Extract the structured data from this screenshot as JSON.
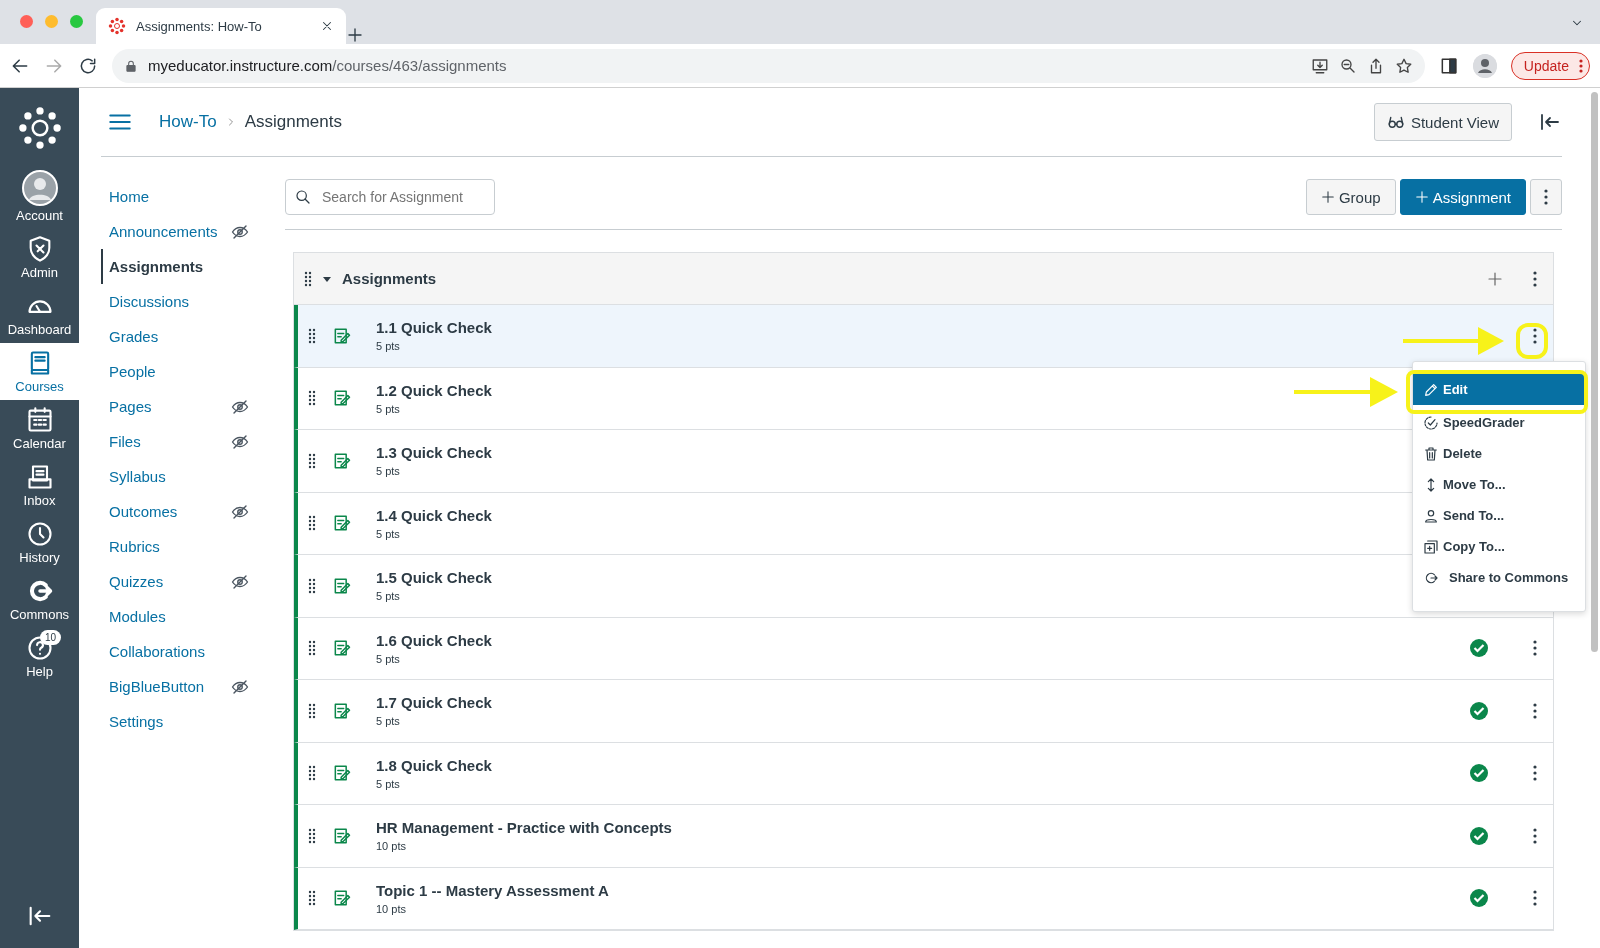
{
  "browser": {
    "tab_title": "Assignments: How-To",
    "url_host": "myeducator.instructure.com",
    "url_path": "/courses/463/assignments",
    "update_button": "Update"
  },
  "global_nav": [
    {
      "label": "Account",
      "kind": "account",
      "selected": false
    },
    {
      "label": "Admin",
      "kind": "admin",
      "selected": false
    },
    {
      "label": "Dashboard",
      "kind": "dashboard",
      "selected": false
    },
    {
      "label": "Courses",
      "kind": "courses",
      "selected": true
    },
    {
      "label": "Calendar",
      "kind": "calendar",
      "selected": false
    },
    {
      "label": "Inbox",
      "kind": "inbox",
      "selected": false
    },
    {
      "label": "History",
      "kind": "history",
      "selected": false
    },
    {
      "label": "Commons",
      "kind": "commons",
      "selected": false
    },
    {
      "label": "Help",
      "kind": "help",
      "selected": false,
      "badge": "10"
    }
  ],
  "breadcrumb": [
    "How-To",
    "Assignments"
  ],
  "student_view_button": "Student View",
  "course_nav": [
    {
      "label": "Home",
      "selected": false,
      "hidden": false
    },
    {
      "label": "Announcements",
      "selected": false,
      "hidden": true
    },
    {
      "label": "Assignments",
      "selected": true,
      "hidden": false
    },
    {
      "label": "Discussions",
      "selected": false,
      "hidden": false
    },
    {
      "label": "Grades",
      "selected": false,
      "hidden": false
    },
    {
      "label": "People",
      "selected": false,
      "hidden": false
    },
    {
      "label": "Pages",
      "selected": false,
      "hidden": true
    },
    {
      "label": "Files",
      "selected": false,
      "hidden": true
    },
    {
      "label": "Syllabus",
      "selected": false,
      "hidden": false
    },
    {
      "label": "Outcomes",
      "selected": false,
      "hidden": true
    },
    {
      "label": "Rubrics",
      "selected": false,
      "hidden": false
    },
    {
      "label": "Quizzes",
      "selected": false,
      "hidden": true
    },
    {
      "label": "Modules",
      "selected": false,
      "hidden": false
    },
    {
      "label": "Collaborations",
      "selected": false,
      "hidden": false
    },
    {
      "label": "BigBlueButton",
      "selected": false,
      "hidden": true
    },
    {
      "label": "Settings",
      "selected": false,
      "hidden": false
    }
  ],
  "search": {
    "placeholder": "Search for Assignment"
  },
  "buttons": {
    "group": "Group",
    "assignment": "Assignment"
  },
  "assignment_group": {
    "title": "Assignments",
    "expanded": true,
    "items": [
      {
        "title": "1.1 Quick Check",
        "points": "5 pts",
        "selected": true
      },
      {
        "title": "1.2 Quick Check",
        "points": "5 pts",
        "selected": false
      },
      {
        "title": "1.3 Quick Check",
        "points": "5 pts",
        "selected": false
      },
      {
        "title": "1.4 Quick Check",
        "points": "5 pts",
        "selected": false
      },
      {
        "title": "1.5 Quick Check",
        "points": "5 pts",
        "selected": false
      },
      {
        "title": "1.6 Quick Check",
        "points": "5 pts",
        "selected": false,
        "published": true
      },
      {
        "title": "1.7 Quick Check",
        "points": "5 pts",
        "selected": false,
        "published": true
      },
      {
        "title": "1.8 Quick Check",
        "points": "5 pts",
        "selected": false,
        "published": true
      },
      {
        "title": "HR Management - Practice with Concepts",
        "points": "10 pts",
        "selected": false,
        "published": true
      },
      {
        "title": "Topic 1 -- Mastery Assessment A",
        "points": "10 pts",
        "selected": false,
        "published": true
      }
    ]
  },
  "menu": {
    "items": [
      {
        "label": "Edit",
        "kind": "edit",
        "selected": true
      },
      {
        "label": "SpeedGrader",
        "kind": "speedgrader",
        "selected": false
      },
      {
        "label": "Delete",
        "kind": "delete",
        "selected": false
      },
      {
        "label": "Move To...",
        "kind": "move",
        "selected": false
      },
      {
        "label": "Send To...",
        "kind": "send",
        "selected": false
      },
      {
        "label": "Copy To...",
        "kind": "copy",
        "selected": false
      },
      {
        "label": "Share to Commons",
        "kind": "commons",
        "selected": false
      }
    ]
  }
}
